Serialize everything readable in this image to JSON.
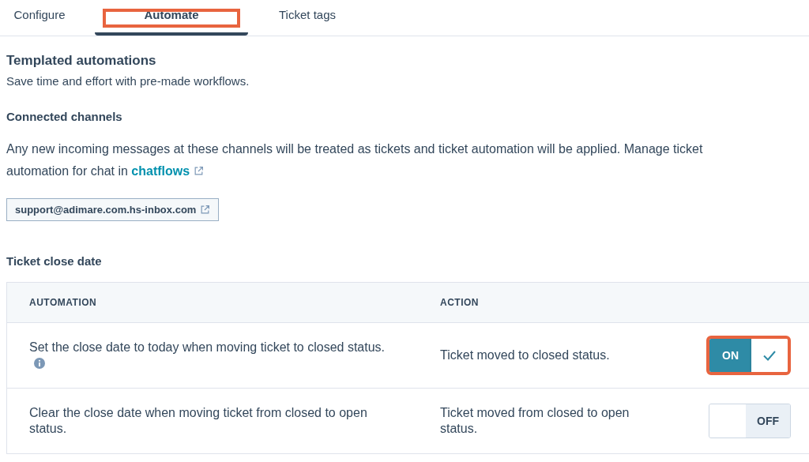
{
  "tabs": [
    {
      "label": "Configure",
      "selected": false,
      "highlighted": false
    },
    {
      "label": "Automate",
      "selected": true,
      "highlighted": true
    },
    {
      "label": "Ticket tags",
      "selected": false,
      "highlighted": false
    }
  ],
  "intro": {
    "title": "Templated automations",
    "subtitle": "Save time and effort with pre-made workflows."
  },
  "connected_channels": {
    "title": "Connected channels",
    "description": "Any new incoming messages at these channels will be treated as tickets and ticket automation will be applied. Manage ticket automation for chat in",
    "link": "chatflows",
    "channels": [
      "support@adimare.com.hs-inbox.com"
    ]
  },
  "ticket_close_date": {
    "title": "Ticket close date",
    "columns": [
      "AUTOMATION",
      "ACTION"
    ],
    "rows": [
      {
        "automation": "Set the close date to today when moving ticket to closed status.",
        "info": true,
        "action": "Ticket moved to closed status.",
        "on": true,
        "label": "ON",
        "highlighted": true
      },
      {
        "automation": "Clear the close date when moving ticket from closed to open status.",
        "info": false,
        "action": "Ticket moved from closed to open status.",
        "on": false,
        "label": "OFF",
        "highlighted": false
      }
    ]
  }
}
